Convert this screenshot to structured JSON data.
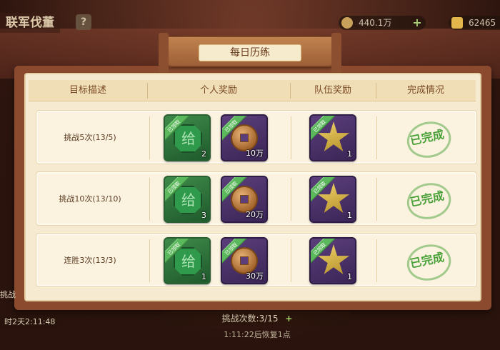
{
  "header": {
    "screen_title": "联军伐董",
    "help_label": "?",
    "resources": [
      {
        "icon": "copper-coin-icon",
        "value": "440.1万",
        "color": "#c9a15a"
      },
      {
        "icon": "gold-ingot-icon",
        "value": "62465",
        "color": "#e3b64b"
      }
    ],
    "add_label": "+"
  },
  "panel": {
    "title": "每日历练",
    "columns": [
      "目标描述",
      "个人奖励",
      "队伍奖励",
      "完成情况"
    ]
  },
  "rows": [
    {
      "desc": "挑战5次(13/5)",
      "rewards": [
        {
          "icon": "jade-token-icon",
          "count": "2",
          "badge": "已领取"
        },
        {
          "icon": "copper-coin-icon",
          "count": "10万",
          "badge": "已领取"
        }
      ],
      "team_reward": {
        "icon": "star-icon",
        "count": "1",
        "badge": "已领取"
      },
      "status": "已完成"
    },
    {
      "desc": "挑战10次(13/10)",
      "rewards": [
        {
          "icon": "jade-token-icon",
          "count": "3",
          "badge": "已领取"
        },
        {
          "icon": "copper-coin-icon",
          "count": "20万",
          "badge": "已领取"
        }
      ],
      "team_reward": {
        "icon": "star-icon",
        "count": "1",
        "badge": "已领取"
      },
      "status": "已完成"
    },
    {
      "desc": "连胜3次(13/3)",
      "rewards": [
        {
          "icon": "jade-token-icon",
          "count": "1",
          "badge": "已领取"
        },
        {
          "icon": "copper-coin-icon",
          "count": "30万",
          "badge": "已领取"
        }
      ],
      "team_reward": {
        "icon": "star-icon",
        "count": "1",
        "badge": "已领取"
      },
      "status": "已完成"
    }
  ],
  "footer": {
    "challenge_count": "挑战次数:3/15",
    "recover_text": "1:11:22后恢复1点",
    "left_timer": "时2天2:11:48",
    "left_side_text": "挑战"
  },
  "colors": {
    "panel_bg": "#8b4a2e",
    "parchment": "#f6ead0",
    "done_green": "#4aa13a",
    "item_purple": "#5b3e7a",
    "item_green": "#3e8a4a"
  }
}
